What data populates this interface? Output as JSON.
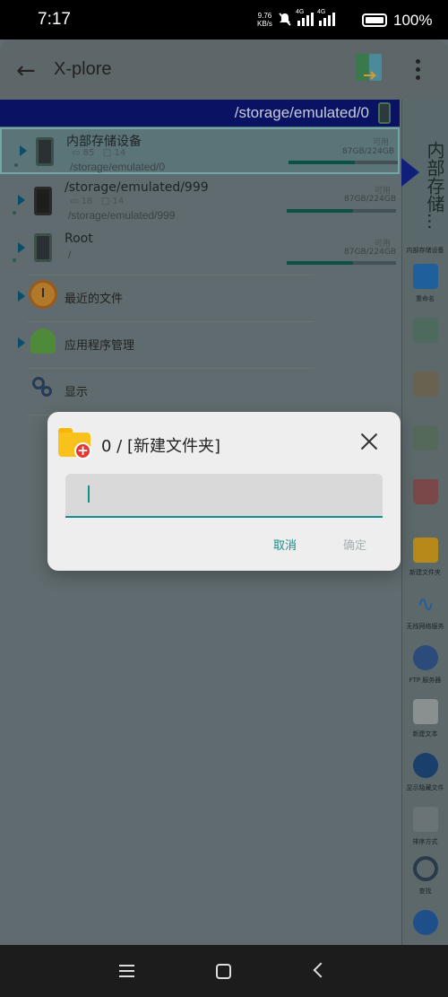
{
  "status_bar": {
    "time": "7:17",
    "net_speed_value": "9.76",
    "net_speed_unit": "KB/s",
    "signal1_label": "4G",
    "signal2_label": "4G",
    "battery": "100%"
  },
  "app": {
    "title": "X-plore",
    "path": "/storage/emulated/0"
  },
  "storage_rows": [
    {
      "title": "内部存储设备",
      "folders": "85",
      "files": "14",
      "path": "/storage/emulated/0",
      "available_label": "可用",
      "size": "87GB/224GB",
      "used_fraction": 0.61
    },
    {
      "title": "/storage/emulated/999",
      "folders": "18",
      "files": "14",
      "path": "/storage/emulated/999",
      "available_label": "可用",
      "size": "87GB/224GB",
      "used_fraction": 0.61
    },
    {
      "title": "Root",
      "path": "/",
      "available_label": "可用",
      "size": "87GB/224GB",
      "used_fraction": 0.61
    }
  ],
  "menu": {
    "recent": "最近的文件",
    "apps": "应用程序管理",
    "display": "显示"
  },
  "sidebar": {
    "current": "内部存储...",
    "tools": [
      {
        "label": "内部存储设备",
        "icon": "storage-icon"
      },
      {
        "label": "重命名",
        "icon": "rename-icon"
      },
      {
        "label": "",
        "icon": "copy-icon"
      },
      {
        "label": "",
        "icon": "clipboard-icon"
      },
      {
        "label": "",
        "icon": "move-icon"
      },
      {
        "label": "",
        "icon": "delete-icon"
      },
      {
        "label": "新建文件夹",
        "icon": "new-folder-icon"
      },
      {
        "label": "无线网络服务",
        "icon": "wifi-icon"
      },
      {
        "label": "FTP 服务器",
        "icon": "ftp-icon"
      },
      {
        "label": "新建文本",
        "icon": "new-text-icon"
      },
      {
        "label": "显示隐藏文件",
        "icon": "eye-hidden-icon"
      },
      {
        "label": "排序方式",
        "icon": "sort-icon"
      },
      {
        "label": "查找",
        "icon": "search-icon"
      },
      {
        "label": "",
        "icon": "settings-icon"
      }
    ]
  },
  "dialog": {
    "title": "0 / [新建文件夹]",
    "input_value": "",
    "cancel": "取消",
    "ok": "确定"
  },
  "colors": {
    "accent": "#178d8a",
    "path_bar": "#0a1263",
    "folder": "#f8c11c",
    "plus_badge": "#e53935"
  }
}
